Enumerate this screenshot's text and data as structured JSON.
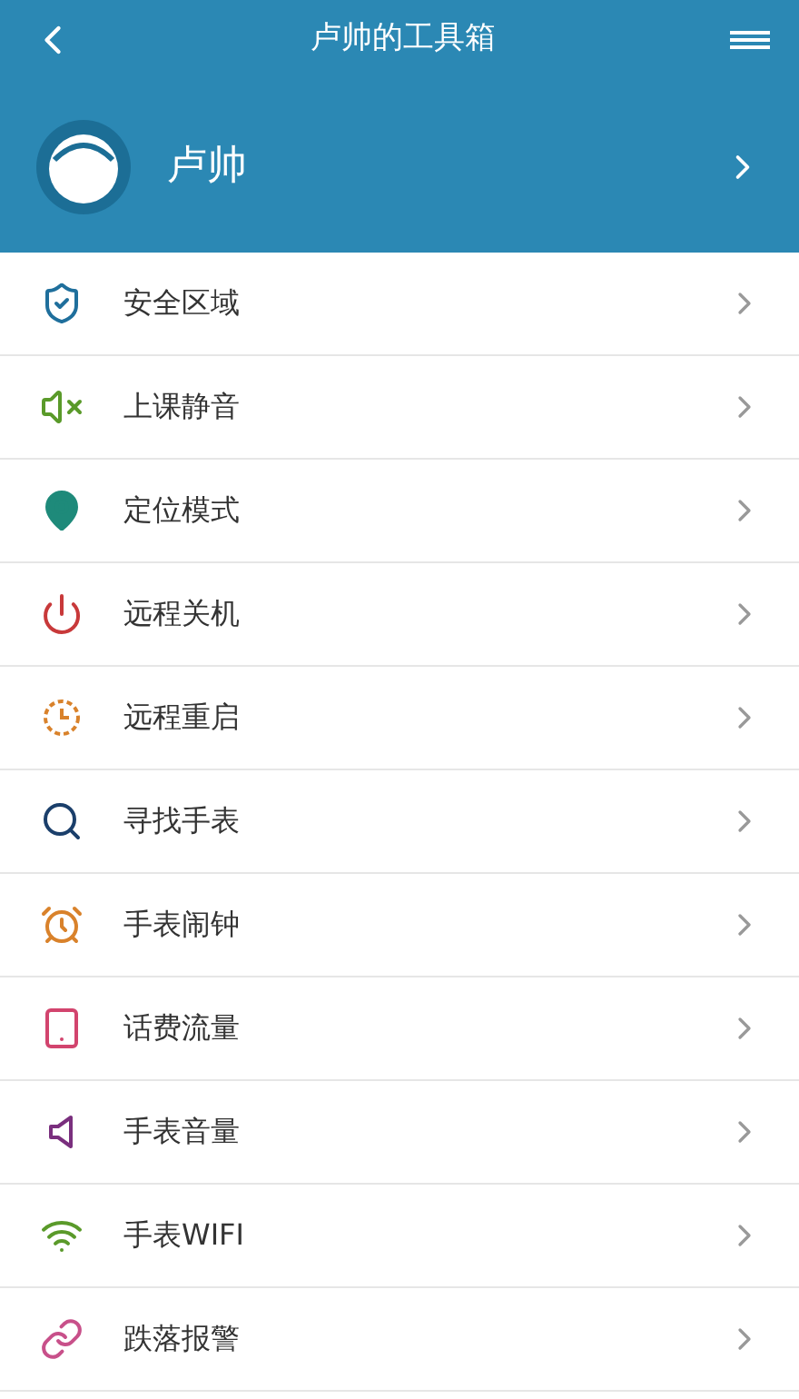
{
  "top_bar": {
    "title": "卢帅的工具箱"
  },
  "profile": {
    "name": "卢帅"
  },
  "menu": [
    {
      "label": "安全区域"
    },
    {
      "label": "上课静音"
    },
    {
      "label": "定位模式"
    },
    {
      "label": "远程关机"
    },
    {
      "label": "远程重启"
    },
    {
      "label": "寻找手表"
    },
    {
      "label": "手表闹钟"
    },
    {
      "label": "话费流量"
    },
    {
      "label": "手表音量"
    },
    {
      "label": "手表WIFI"
    },
    {
      "label": "跌落报警"
    }
  ]
}
